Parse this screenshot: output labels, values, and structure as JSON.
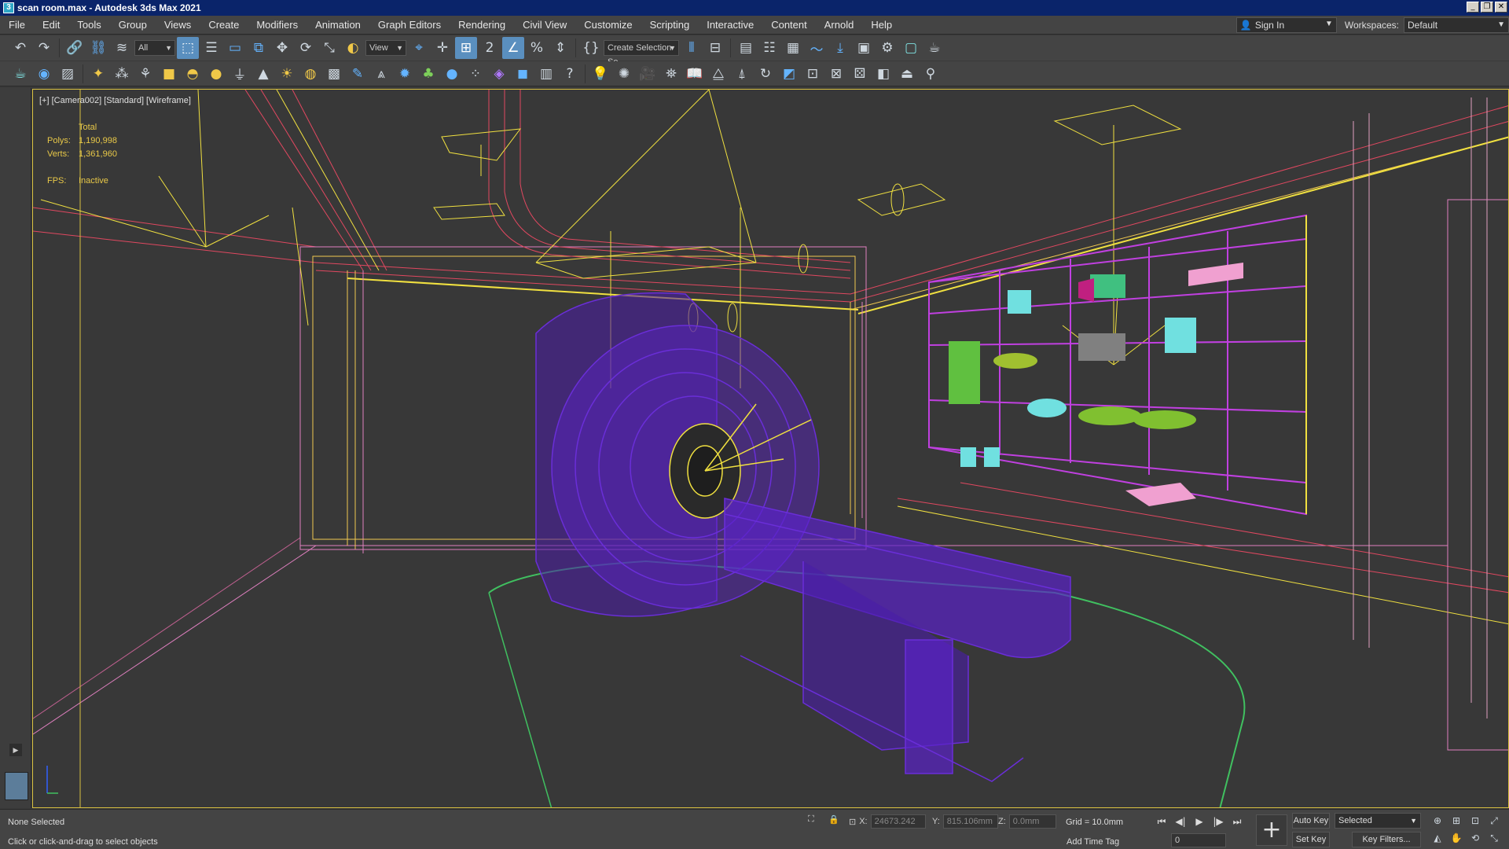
{
  "window": {
    "title": "scan room.max - Autodesk 3ds Max 2021",
    "icon": "3ds-max-icon",
    "controls": [
      "minimize",
      "restore",
      "close"
    ]
  },
  "menu": {
    "items": [
      "File",
      "Edit",
      "Tools",
      "Group",
      "Views",
      "Create",
      "Modifiers",
      "Animation",
      "Graph Editors",
      "Rendering",
      "Civil View",
      "Customize",
      "Scripting",
      "Interactive",
      "Content",
      "Arnold",
      "Help"
    ],
    "sign_in": "Sign In",
    "workspaces_label": "Workspaces:",
    "workspace_value": "Default"
  },
  "toolbar": {
    "selection_filter": "All",
    "reference_coord": "View",
    "named_selection": "Create Selection Se"
  },
  "viewport": {
    "label": "[+] [Camera002] [Standard] [Wireframe]",
    "stats": {
      "total_label": "Total",
      "polys_label": "Polys:",
      "polys_value": "1,190,998",
      "verts_label": "Verts:",
      "verts_value": "1,361,960",
      "fps_label": "FPS:",
      "fps_value": "Inactive"
    }
  },
  "status": {
    "selection": "None Selected",
    "prompt": "Click or click-and-drag to select objects",
    "x_label": "X:",
    "x_value": "24673.242",
    "y_label": "Y:",
    "y_value": "815.106mm",
    "z_label": "Z:",
    "z_value": "0.0mm",
    "grid": "Grid = 10.0mm",
    "add_time_tag": "Add Time Tag",
    "frame": "0",
    "auto_key": "Auto Key",
    "set_key": "Set Key",
    "key_mode": "Selected",
    "key_filters": "Key Filters..."
  },
  "colors": {
    "title_bar": "#0a246a",
    "viewport_border": "#d8c040",
    "scanner_wire": "#6a2ed8",
    "shelf_wire": "#c040e0",
    "light_wire": "#f0e040",
    "room_wire": "#e04860",
    "accent": "#5a8fbf"
  }
}
